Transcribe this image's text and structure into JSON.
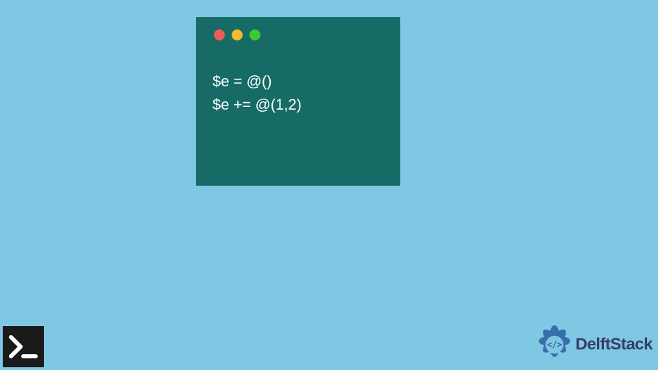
{
  "terminal": {
    "lights": {
      "red": "#EC5D57",
      "yellow": "#F2BC30",
      "green": "#3EC930"
    },
    "code_lines": [
      "$e = @()",
      "$e += @(1,2)"
    ]
  },
  "icons": {
    "powershell": "powershell-icon",
    "delftstack": "delftstack-logo"
  },
  "brand": {
    "name": "DelftStack"
  },
  "colors": {
    "background": "#7EC8E3",
    "terminal_bg": "#166B66",
    "code_text": "#FFFFFF",
    "brand_text": "#3B3B6D",
    "brand_logo": "#2E5FA3"
  }
}
